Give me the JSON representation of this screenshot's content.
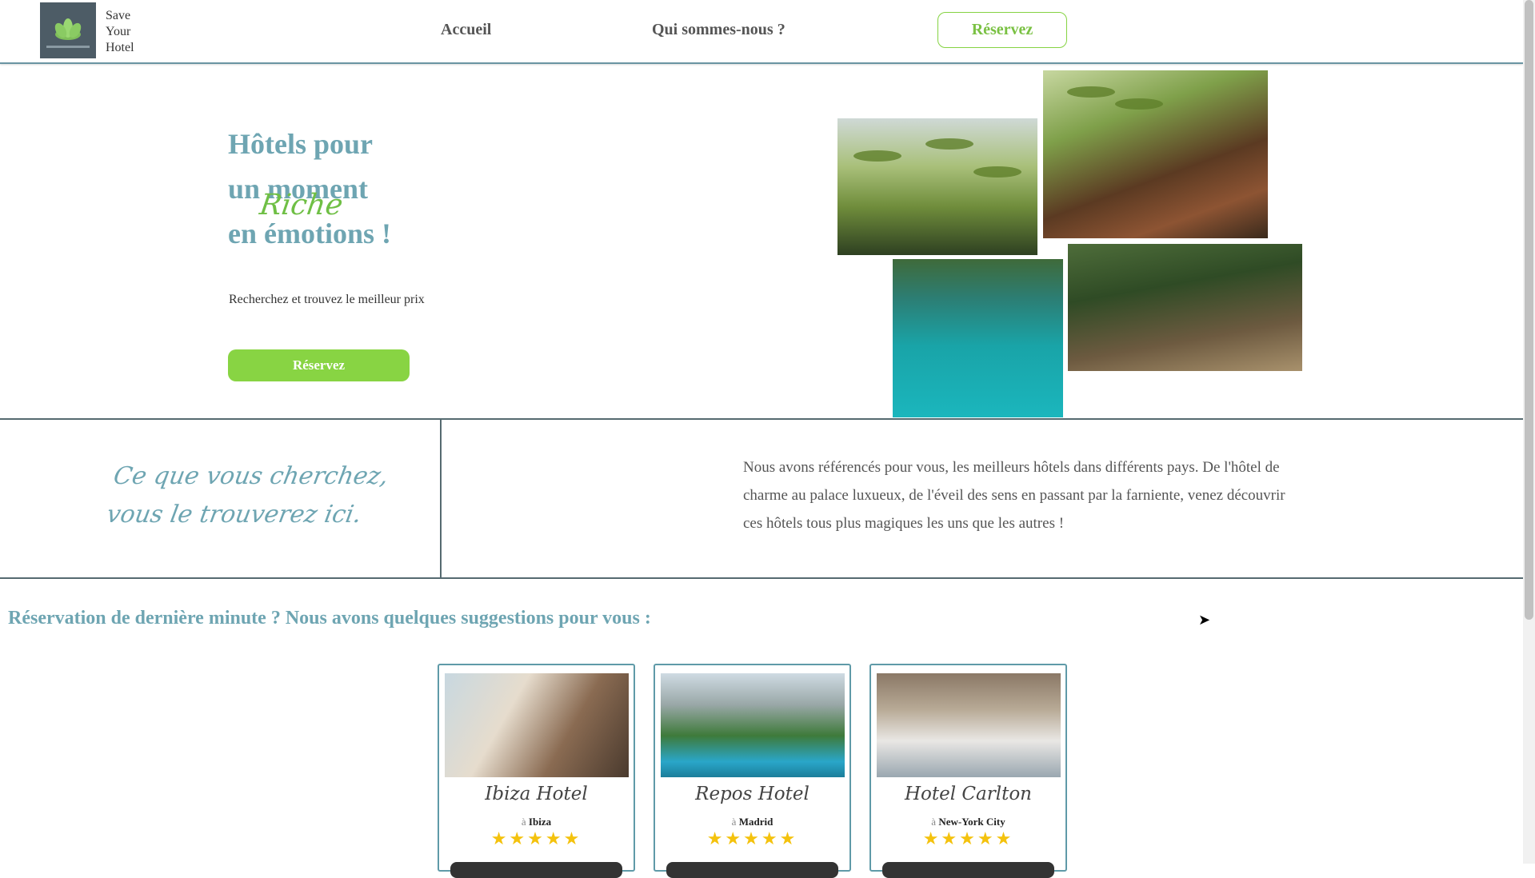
{
  "header": {
    "logo_lines": [
      "Save",
      "Your",
      "Hotel"
    ],
    "nav": [
      "Accueil",
      "Qui sommes-nous ?"
    ],
    "cta": "Réservez"
  },
  "hero": {
    "title_1": "Hôtels pour",
    "title_2": "un moment",
    "title_3": "en émotions !",
    "script_word": "Riche",
    "subtitle": "Recherchez et trouvez le meilleur prix",
    "button": "Réservez"
  },
  "intro": {
    "quote_1": "Ce que vous cherchez,",
    "quote_2": "vous le trouverez ici.",
    "text": "Nous avons référencés pour vous, les meilleurs hôtels dans différents pays. De l'hôtel de charme au palace luxueux, de l'éveil des sens en passant par la farniente, venez découvrir ces hôtels tous plus magiques les uns que les autres !"
  },
  "suggestions": {
    "title": "Réservation de dernière minute ? Nous avons quelques suggestions pour vous :",
    "city_prefix": "à",
    "cards": [
      {
        "name": "Ibiza Hotel",
        "city": "Ibiza",
        "stars": "★★★★★",
        "rating": 5
      },
      {
        "name": "Repos Hotel",
        "city": "Madrid",
        "stars": "★★★★★",
        "rating": 5
      },
      {
        "name": "Hotel Carlton",
        "city": "New-York City",
        "stars": "★★★★★",
        "rating": 5
      }
    ]
  },
  "colors": {
    "accent_teal": "#6ea5b2",
    "accent_green": "#88d443",
    "star": "#f4c20d"
  }
}
